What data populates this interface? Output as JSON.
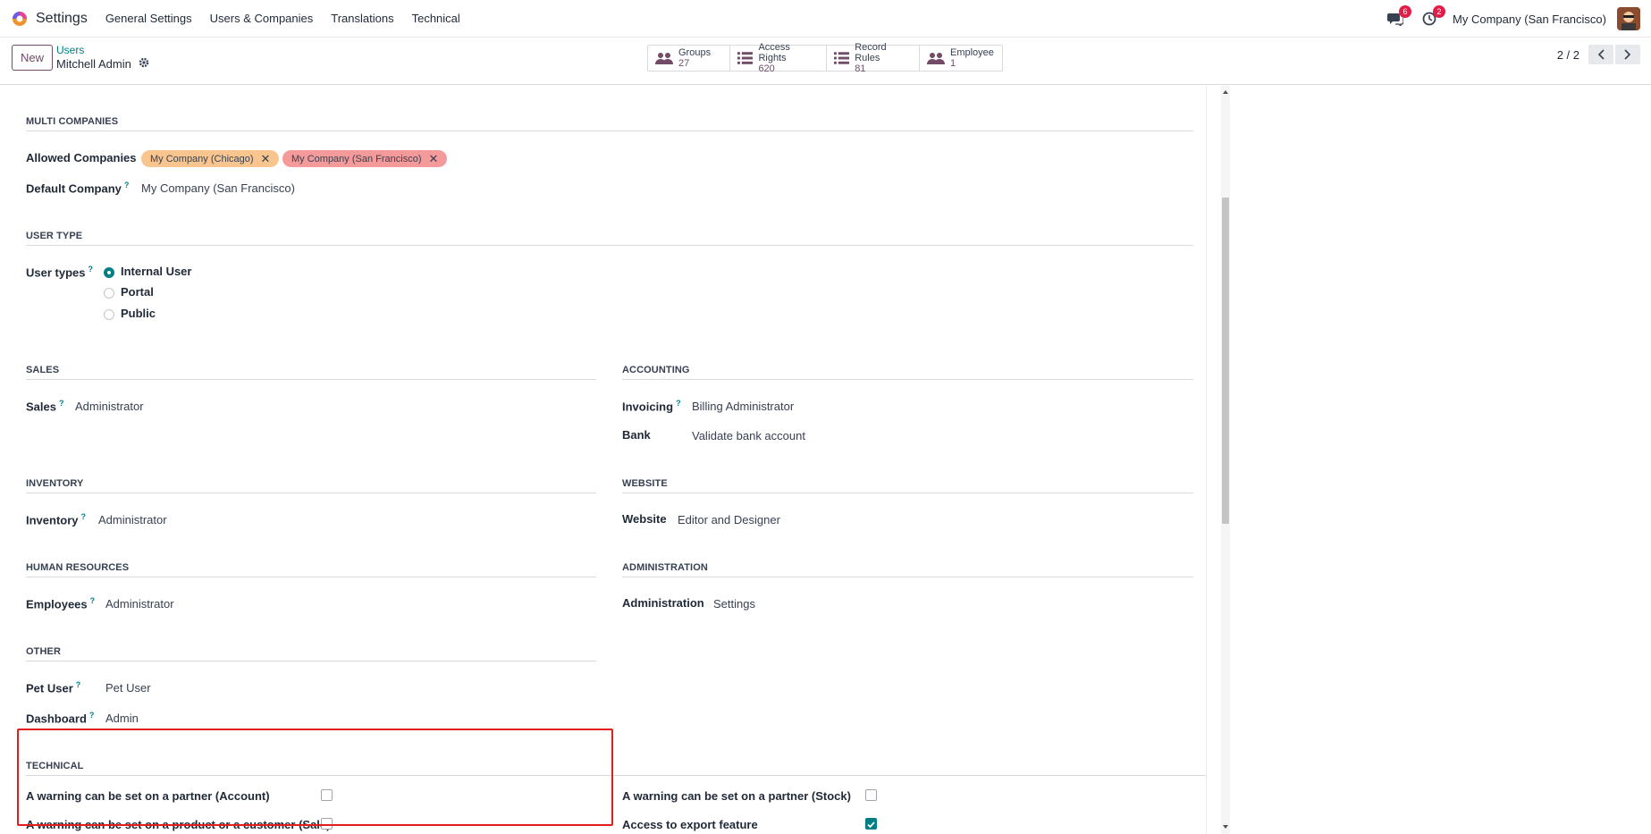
{
  "navbar": {
    "app_name": "Settings",
    "menu": [
      "General Settings",
      "Users & Companies",
      "Translations",
      "Technical"
    ],
    "messages_count": "6",
    "activities_count": "2",
    "company": "My Company (San Francisco)"
  },
  "control": {
    "new_label": "New",
    "breadcrumb_parent": "Users",
    "breadcrumb_current": "Mitchell Admin",
    "stats": [
      {
        "label": "Groups",
        "value": "27"
      },
      {
        "label": "Access Rights",
        "value": "620"
      },
      {
        "label": "Record Rules",
        "value": "81"
      },
      {
        "label": "Employee",
        "value": "1"
      }
    ],
    "pager": "2 / 2"
  },
  "multi_companies": {
    "title": "MULTI COMPANIES",
    "allowed_label": "Allowed Companies",
    "allowed": [
      {
        "name": "My Company (Chicago)",
        "color": "#f9c58e"
      },
      {
        "name": "My Company (San Francisco)",
        "color": "#f49a9a"
      }
    ],
    "default_label": "Default Company",
    "default_value": "My Company (San Francisco)"
  },
  "user_type": {
    "title": "USER TYPE",
    "label": "User types",
    "options": [
      "Internal User",
      "Portal",
      "Public"
    ],
    "selected": "Internal User"
  },
  "sales": {
    "title": "SALES",
    "label": "Sales",
    "value": "Administrator"
  },
  "accounting": {
    "title": "ACCOUNTING",
    "invoicing_label": "Invoicing",
    "invoicing_value": "Billing Administrator",
    "bank_label": "Bank",
    "bank_value": "Validate bank account"
  },
  "inventory": {
    "title": "INVENTORY",
    "label": "Inventory",
    "value": "Administrator"
  },
  "website": {
    "title": "WEBSITE",
    "label": "Website",
    "value": "Editor and Designer"
  },
  "human_resources": {
    "title": "HUMAN RESOURCES",
    "label": "Employees",
    "value": "Administrator"
  },
  "administration": {
    "title": "ADMINISTRATION",
    "label": "Administration",
    "value": "Settings"
  },
  "other": {
    "title": "OTHER",
    "pet_label": "Pet User",
    "pet_value": "Pet User",
    "dashboard_label": "Dashboard",
    "dashboard_value": "Admin"
  },
  "technical": {
    "title": "TECHNICAL",
    "items": [
      {
        "label": "A warning can be set on a partner (Account)",
        "checked": false
      },
      {
        "label": "A warning can be set on a partner (Stock)",
        "checked": false
      },
      {
        "label": "A warning can be set on a product or a customer (Sale)",
        "checked": false
      },
      {
        "label": "Access to export feature",
        "checked": true
      }
    ]
  },
  "colors": {
    "accent": "#714b67",
    "teal": "#017e84",
    "highlight": "#e11d1d"
  }
}
